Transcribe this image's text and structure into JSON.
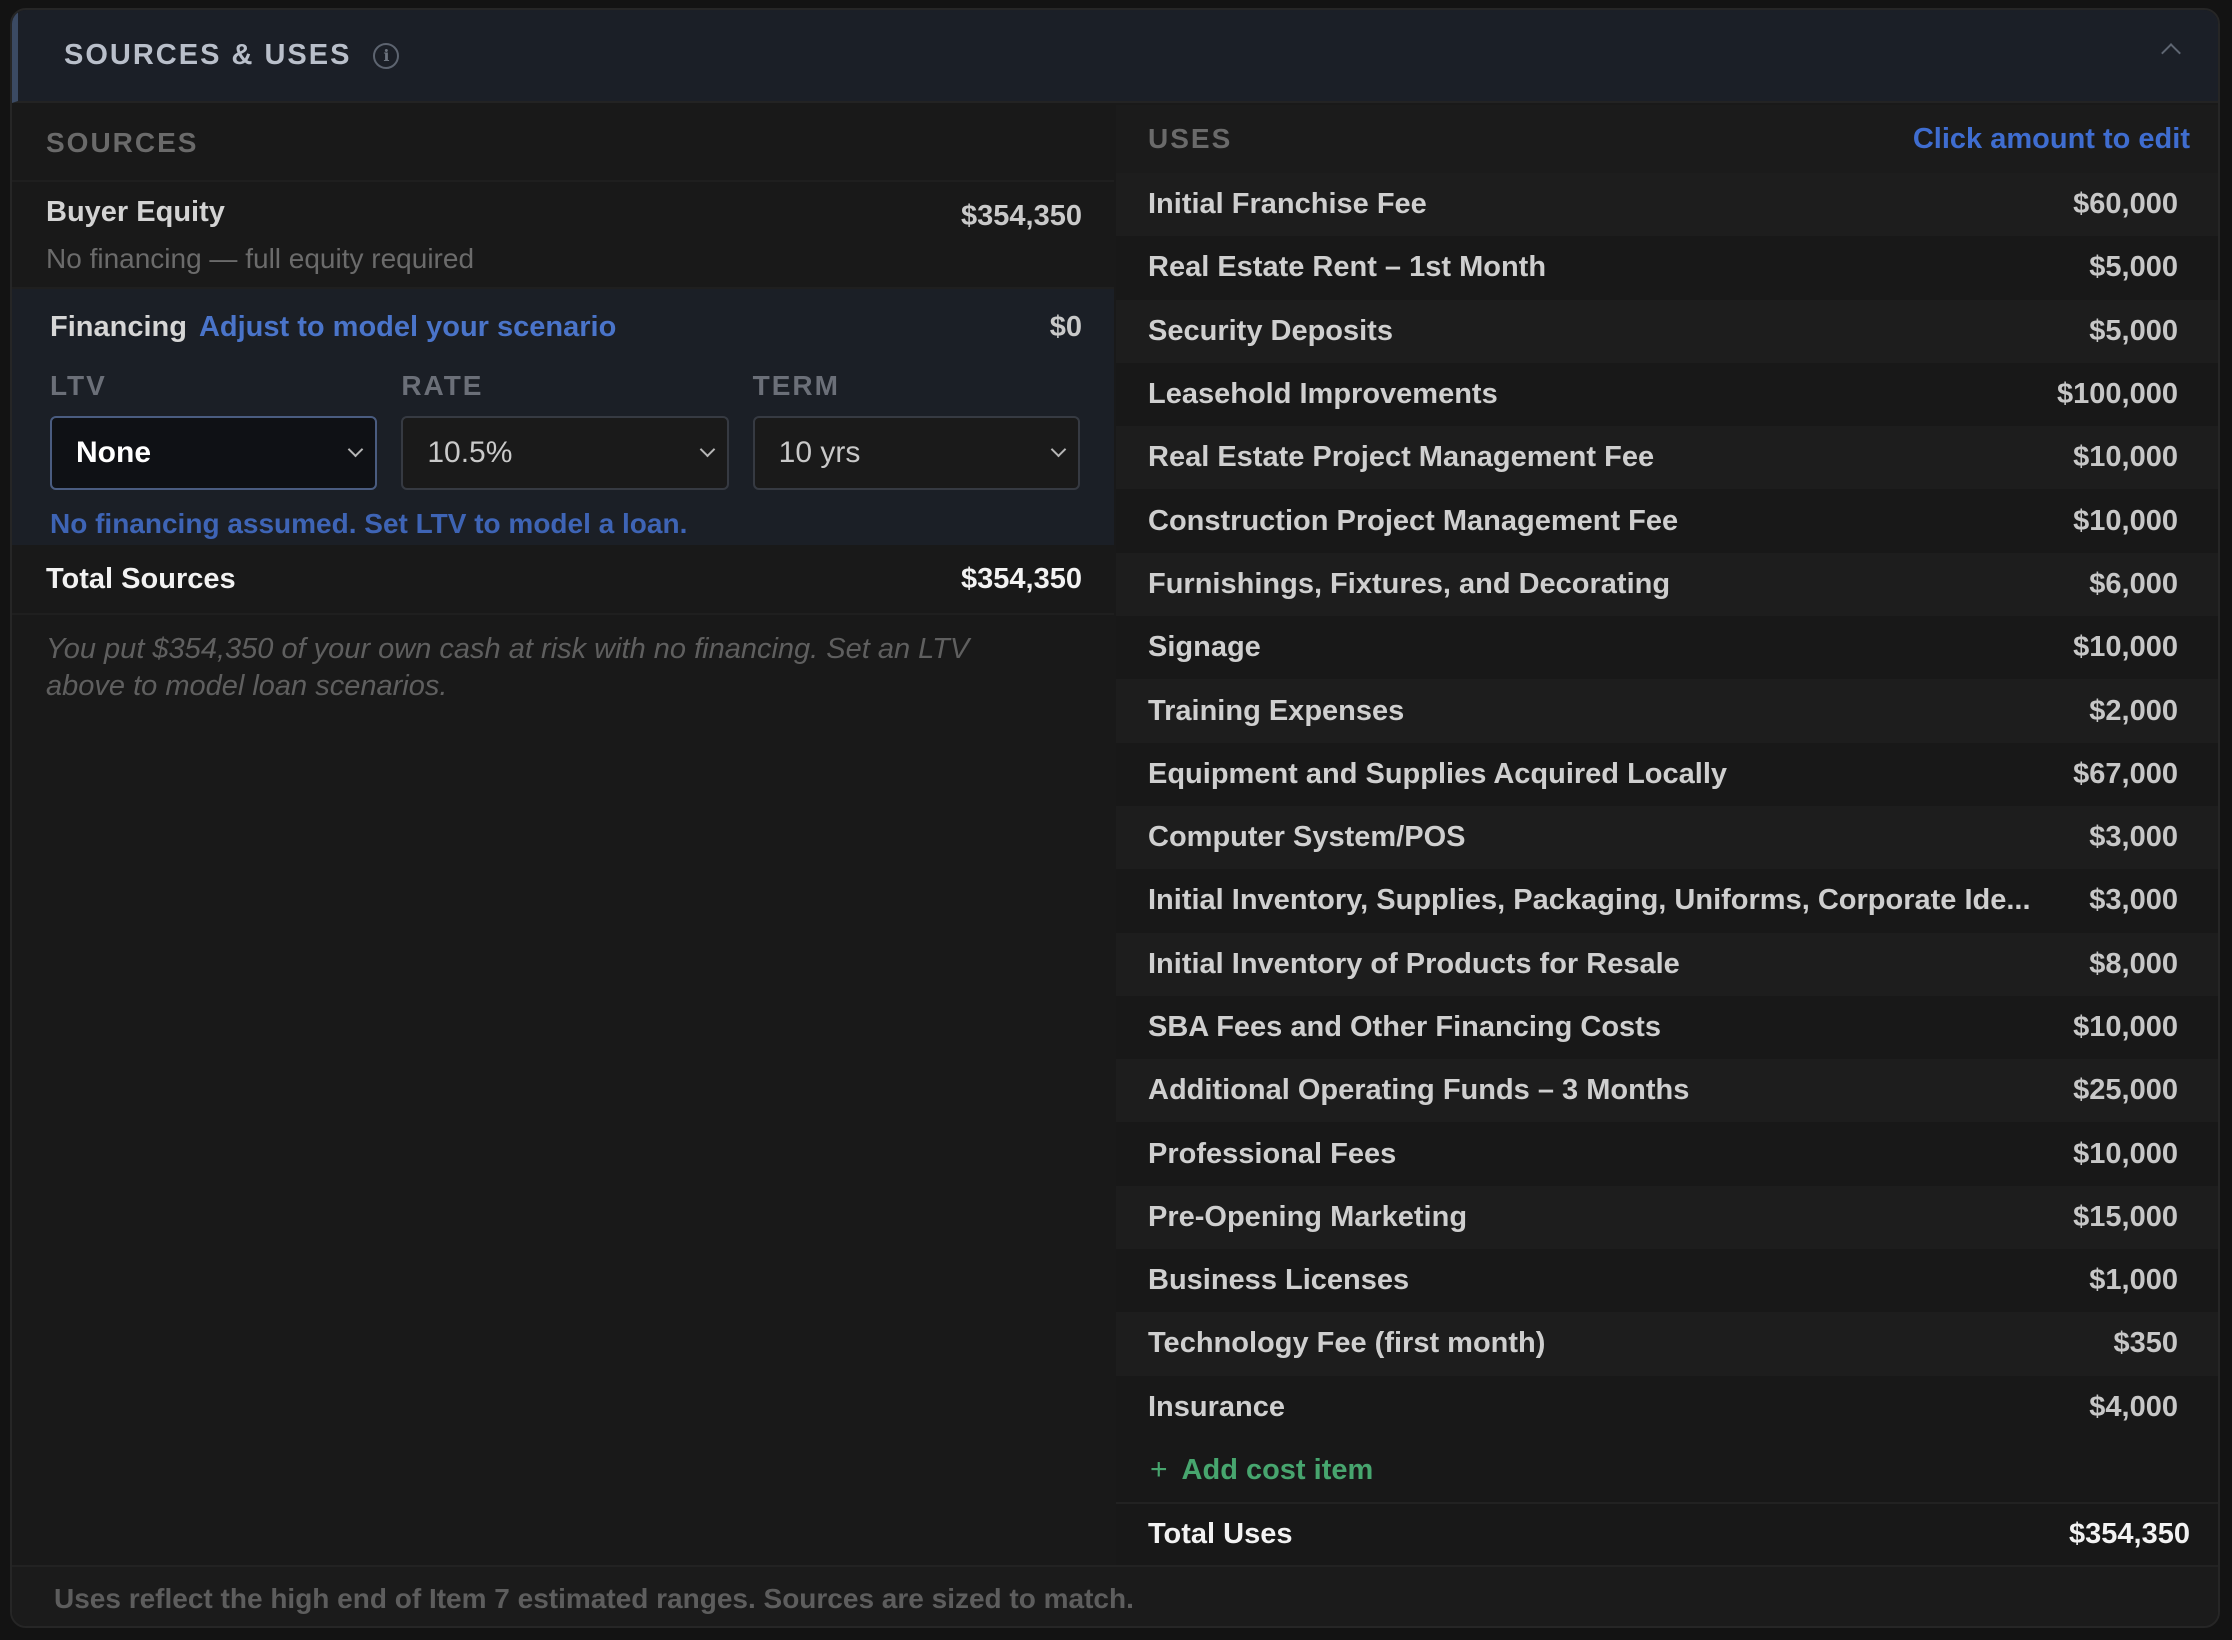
{
  "header": {
    "title": "SOURCES & USES",
    "info_icon": "info-icon",
    "collapse_icon": "chevron-up-icon"
  },
  "sources": {
    "heading": "SOURCES",
    "equity": {
      "label": "Buyer Equity",
      "sub": "No financing — full equity required",
      "value": "$354,350"
    },
    "financing": {
      "label": "Financing",
      "link": "Adjust to model your scenario",
      "value": "$0",
      "ltv": {
        "label": "LTV",
        "value": "None"
      },
      "rate": {
        "label": "RATE",
        "value": "10.5%"
      },
      "term": {
        "label": "TERM",
        "value": "10 yrs"
      },
      "note": "No financing assumed. Set LTV to model a loan."
    },
    "total": {
      "label": "Total Sources",
      "value": "$354,350"
    },
    "note": "You put $354,350 of your own cash at risk with no financing. Set an LTV above to model loan scenarios."
  },
  "uses": {
    "heading": "USES",
    "hint": "Click amount to edit",
    "items": [
      {
        "name": "Initial Franchise Fee",
        "amount": "$60,000"
      },
      {
        "name": "Real Estate Rent – 1st Month",
        "amount": "$5,000"
      },
      {
        "name": "Security Deposits",
        "amount": "$5,000"
      },
      {
        "name": "Leasehold Improvements",
        "amount": "$100,000"
      },
      {
        "name": "Real Estate Project Management Fee",
        "amount": "$10,000"
      },
      {
        "name": "Construction Project Management Fee",
        "amount": "$10,000"
      },
      {
        "name": "Furnishings, Fixtures, and Decorating",
        "amount": "$6,000"
      },
      {
        "name": "Signage",
        "amount": "$10,000"
      },
      {
        "name": "Training Expenses",
        "amount": "$2,000"
      },
      {
        "name": "Equipment and Supplies Acquired Locally",
        "amount": "$67,000"
      },
      {
        "name": "Computer System/POS",
        "amount": "$3,000"
      },
      {
        "name": "Initial Inventory, Supplies, Packaging, Uniforms, Corporate Ide...",
        "amount": "$3,000"
      },
      {
        "name": "Initial Inventory of Products for Resale",
        "amount": "$8,000"
      },
      {
        "name": "SBA Fees and Other Financing Costs",
        "amount": "$10,000"
      },
      {
        "name": "Additional Operating Funds – 3 Months",
        "amount": "$25,000"
      },
      {
        "name": "Professional Fees",
        "amount": "$10,000"
      },
      {
        "name": "Pre-Opening Marketing",
        "amount": "$15,000"
      },
      {
        "name": "Business Licenses",
        "amount": "$1,000"
      },
      {
        "name": "Technology Fee (first month)",
        "amount": "$350"
      },
      {
        "name": "Insurance",
        "amount": "$4,000"
      }
    ],
    "add_label": "Add cost item",
    "total": {
      "label": "Total Uses",
      "value": "$354,350"
    }
  },
  "footer": "Uses reflect the high end of Item 7 estimated ranges. Sources are sized to match.",
  "colors": {
    "accent_blue": "#3f6dd0",
    "add_green": "#47a56e",
    "panel_bg": "#191919"
  }
}
